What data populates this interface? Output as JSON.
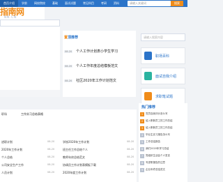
{
  "header": {
    "logo_main": "指南网",
    "logo_sub": "NN.CN",
    "nav": [
      "首页介绍",
      "学前",
      "网校院校",
      "基础",
      "面试试题",
      "常见科目",
      "考研",
      "资料"
    ],
    "search_placeholder": "请输入关键词",
    "search_button": "搜索"
  },
  "banner": {
    "caption": ""
  },
  "recommend": {
    "title_a": "置",
    "title_b": "顶推荐",
    "items": [
      {
        "date": "08-20",
        "title": "个人工作计划表小学生学习",
        "desc": ""
      },
      {
        "date": "08-20",
        "title": "个人工作年度总结模板范文",
        "desc": ""
      },
      {
        "date": "08-20",
        "title": "社区2020年工作计划范文",
        "desc": ""
      }
    ]
  },
  "side": {
    "search_placeholder": "请输入搜索内容",
    "cards": [
      {
        "label": "职场百科",
        "color": "#2b74c9"
      },
      {
        "label": "面试自我介绍",
        "color": "#2bb3a0"
      },
      {
        "label": "求职笔试题",
        "color": "#f08c1a"
      }
    ]
  },
  "hot": {
    "title": "热门推荐",
    "items": [
      "党员自我评价怎么写",
      "给入职新员工的工作总结",
      "给入职新员工的工作总结",
      "毕业生实习报告怎么写",
      "工作总结报告",
      "我们2020年学习总结",
      "党组织生活会个人发言",
      "写述职报告的注意",
      "企业年终总结范文"
    ]
  },
  "bottom": {
    "head": "职场",
    "sub": "工作实习总结表格",
    "rows_left": [
      {
        "text": "述职计划",
        "date": "08-20"
      },
      {
        "text": "2020年工作计划",
        "date": "08-20"
      },
      {
        "text": "个人总结",
        "date": "08-20"
      },
      {
        "text": "公司安全生产工作",
        "date": "08-20"
      },
      {
        "text": "人员计划",
        "date": "08-20"
      }
    ],
    "rows_right": [
      {
        "text": "学校2020年工作计划",
        "date": "08-20"
      },
      {
        "text": "班主任工作总结个人",
        "date": "08-20"
      },
      {
        "text": "教师年终总结范文",
        "date": "08-20"
      },
      {
        "text": "协调员工作计划表模板下载",
        "date": "08-20"
      },
      {
        "text": "2020年度工作计划",
        "date": "08-20"
      }
    ]
  }
}
